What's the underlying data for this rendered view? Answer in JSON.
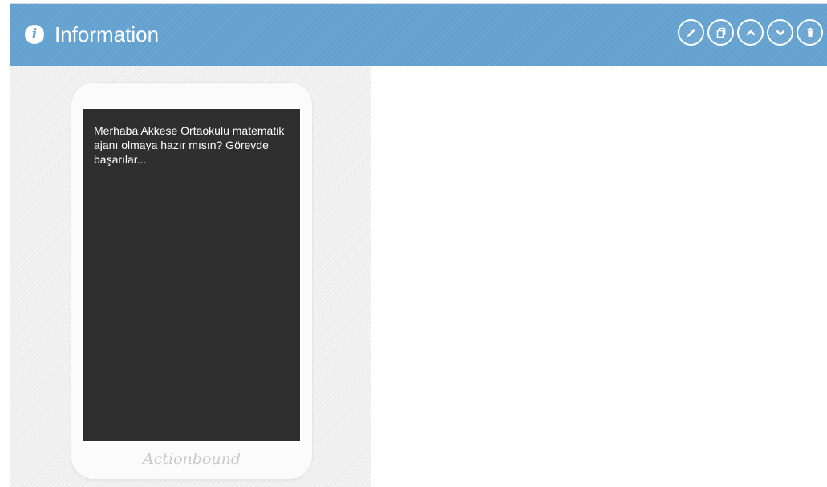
{
  "header": {
    "title": "Information",
    "icon": "info-icon",
    "background_color": "#63a1d0",
    "actions": [
      {
        "name": "edit-button",
        "icon": "pencil-icon"
      },
      {
        "name": "duplicate-button",
        "icon": "copy-icon"
      },
      {
        "name": "move-up-button",
        "icon": "chevron-up-icon"
      },
      {
        "name": "move-down-button",
        "icon": "chevron-down-icon"
      },
      {
        "name": "delete-button",
        "icon": "trash-icon"
      }
    ]
  },
  "preview": {
    "message": "Merhaba Akkese Ortaokulu matematik ajanı olmaya hazır mısın? Görevde başarılar...",
    "brand": "Actionbound",
    "screen_color": "#2f2f2f"
  }
}
